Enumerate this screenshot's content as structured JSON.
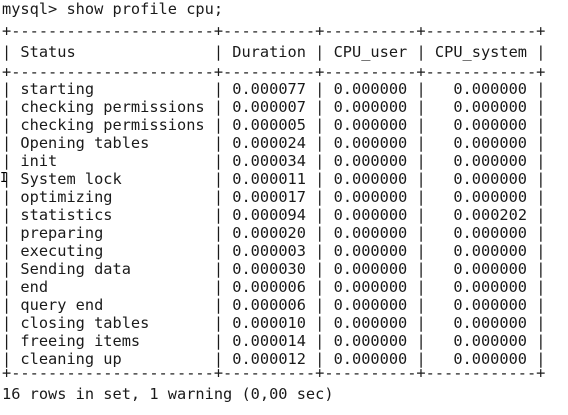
{
  "terminal": {
    "prompt": "mysql> show profile cpu;",
    "border": "+----------------------+----------+----------+------------+",
    "headers": [
      "Status",
      "Duration",
      "CPU_user",
      "CPU_system"
    ],
    "rows": [
      [
        "starting",
        "0.000077",
        "0.000000",
        "0.000000"
      ],
      [
        "checking permissions",
        "0.000007",
        "0.000000",
        "0.000000"
      ],
      [
        "checking permissions",
        "0.000005",
        "0.000000",
        "0.000000"
      ],
      [
        "Opening tables",
        "0.000024",
        "0.000000",
        "0.000000"
      ],
      [
        "init",
        "0.000034",
        "0.000000",
        "0.000000"
      ],
      [
        "System lock",
        "0.000011",
        "0.000000",
        "0.000000"
      ],
      [
        "optimizing",
        "0.000017",
        "0.000000",
        "0.000000"
      ],
      [
        "statistics",
        "0.000094",
        "0.000000",
        "0.000202"
      ],
      [
        "preparing",
        "0.000020",
        "0.000000",
        "0.000000"
      ],
      [
        "executing",
        "0.000003",
        "0.000000",
        "0.000000"
      ],
      [
        "Sending data",
        "0.000030",
        "0.000000",
        "0.000000"
      ],
      [
        "end",
        "0.000006",
        "0.000000",
        "0.000000"
      ],
      [
        "query end",
        "0.000006",
        "0.000000",
        "0.000000"
      ],
      [
        "closing tables",
        "0.000010",
        "0.000000",
        "0.000000"
      ],
      [
        "freeing items",
        "0.000014",
        "0.000000",
        "0.000000"
      ],
      [
        "cleaning up",
        "0.000012",
        "0.000000",
        "0.000000"
      ]
    ],
    "summary": "16 rows in set, 1 warning (0,00 sec)"
  },
  "colors": {
    "background": "#ffffff",
    "text": "#1a1a1a"
  },
  "icons": {
    "mouse_cursor": "text-cursor-icon"
  }
}
